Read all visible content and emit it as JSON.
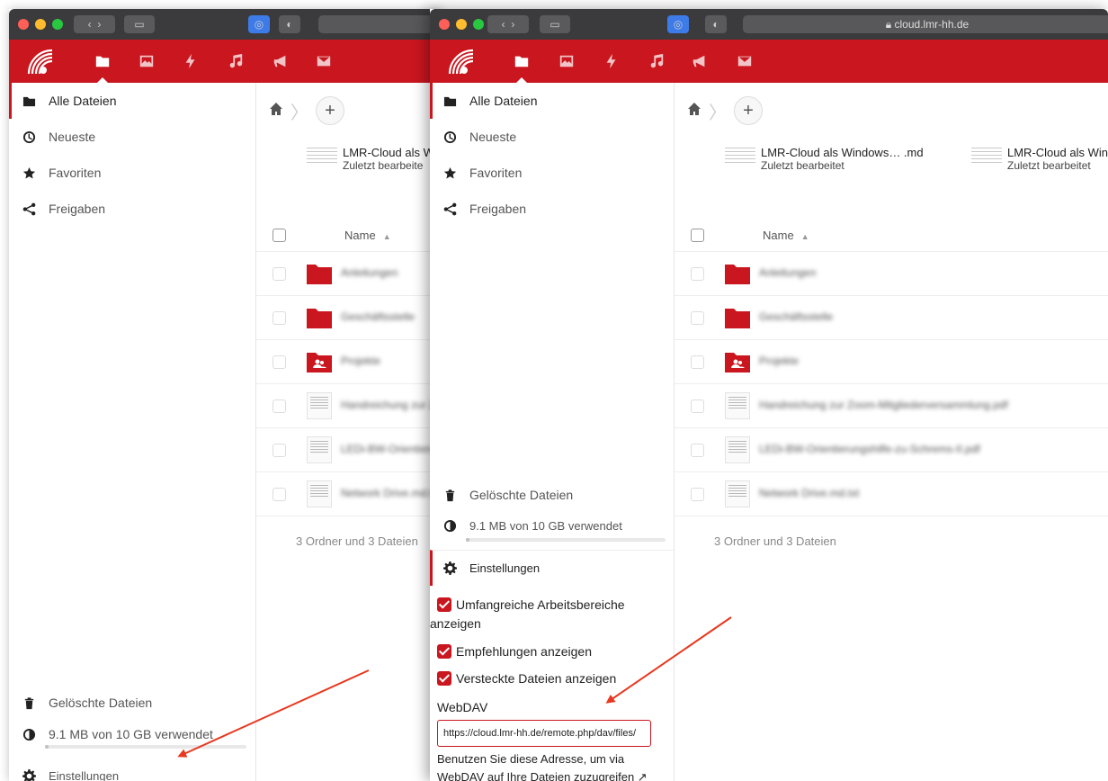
{
  "browser": {
    "url": "cloud.lmr-hh.de"
  },
  "nav": {
    "apps": [
      "files-icon",
      "photos-icon",
      "activity-icon",
      "music-icon",
      "announcements-icon",
      "mail-icon"
    ]
  },
  "sidebar": {
    "items": [
      {
        "label": "Alle Dateien",
        "icon": "folder-icon"
      },
      {
        "label": "Neueste",
        "icon": "clock-icon"
      },
      {
        "label": "Favoriten",
        "icon": "star-icon"
      },
      {
        "label": "Freigaben",
        "icon": "share-icon"
      }
    ],
    "trash_label": "Gelöschte Dateien",
    "quota_label": "9.1 MB von 10 GB verwendet",
    "settings_label": "Einstellungen"
  },
  "recent": [
    {
      "name": "LMR-Cloud als Windows… .md",
      "subtitle": "Zuletzt bearbeitet"
    },
    {
      "name": "LMR-Cloud als Win",
      "subtitle": "Zuletzt bearbeitet"
    }
  ],
  "recent_back": {
    "name": "LMR-Cloud als W",
    "subtitle": "Zuletzt bearbeite"
  },
  "table": {
    "name_header": "Name",
    "rows": [
      {
        "type": "folder",
        "name": "Anleitungen"
      },
      {
        "type": "folder",
        "name": "Geschäftsstelle"
      },
      {
        "type": "shared-folder",
        "name": "Projekte"
      },
      {
        "type": "file",
        "name": "Handreichung zur Zoom-Mitgliederversammlung.pdf"
      },
      {
        "type": "file",
        "name": "LEDi-BW-Orientierungshilfe-zu-Schrems-II.pdf"
      },
      {
        "type": "file",
        "name": "Network Drive.md.txt"
      }
    ],
    "summary": "3 Ordner und 3 Dateien"
  },
  "settings": {
    "options": [
      {
        "label_line1": "Umfangreiche Arbeitsbereiche",
        "label_line2": "anzeigen",
        "checked": true
      },
      {
        "label_line1": "Empfehlungen anzeigen",
        "checked": true
      },
      {
        "label_line1": "Versteckte Dateien anzeigen",
        "checked": true
      }
    ],
    "webdav_label": "WebDAV",
    "webdav_url": "https://cloud.lmr-hh.de/remote.php/dav/files/",
    "webdav_help_line1": "Benutzen Sie diese Adresse, um via",
    "webdav_help_line2": "WebDAV auf Ihre Dateien zuzugreifen ↗"
  },
  "colors": {
    "brand": "#c9161f",
    "annotation_arrow": "#e8381f"
  }
}
